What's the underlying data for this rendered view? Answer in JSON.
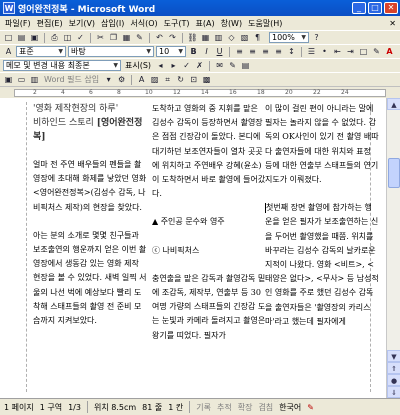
{
  "window": {
    "title": "영어완전정복 - Microsoft Word",
    "icon": "W"
  },
  "menu": [
    "파일(F)",
    "편집(E)",
    "보기(V)",
    "삽입(I)",
    "서식(O)",
    "도구(T)",
    "표(A)",
    "창(W)",
    "도움말(H)"
  ],
  "toolbar": {
    "style_value": "표준",
    "font_value": "바탕",
    "size_value": "10",
    "zoom_value": "100%",
    "track_label": "메모 및 변경 내용 최종본",
    "show_label": "표시(S)",
    "wordart_label": "Word 필드 삽입"
  },
  "ruler": {
    "numbers": [
      "2",
      "4",
      "6",
      "8",
      "10",
      "12",
      "14",
      "16",
      "18",
      "20",
      "22",
      "24"
    ]
  },
  "document": {
    "col1": {
      "heading_a": "'영화 제작현장의 하루'",
      "heading_b": "비하인드 스토리 ",
      "heading_bold": "[영어완전정복]",
      "p1": "얼마 전 주연 배우들의 펜들을 촬영장에 초대해 화제를 낳았던 영화 <영어완전정복>(김성수 감독, 나비픽처스 제작)의 현장을 찾았다.",
      "p2": "아는 분의 소개로 몇몇 친구들과 보조출연의 행운까지 얻은 이번 촬영장에서 생동감 있는 영화 제작 현장을 볼 수 있었다. 새벽 일찍 서울의 나선 벅에 예상보다 빨리 도착해 스태프들의 촬영 전 준비 모습까지 지켜보았다."
    },
    "col2": {
      "p1": "도착하고 영화의 중 지휘를 맡은 김성수 감독이 등장하면서 촬영장은 점점 긴장감이 돌았다. 본디에 대기하던 보조연자들이 열차 곳곳에 위치하고 주연배우 강혜(윤소)이 도착하면서 바로 촬영에 들어갔다.",
      "p2": "▲ 주인공 문수와 영주",
      "p3": "ⓒ 나비픽처스",
      "p4": "충연출을 맡은 감독과 촬영감독 밑에 조감독, 제작부, 연출부 등 30여명 가량의 스태프들의 긴장감 도는 눈빛과 카메라 돌려지고 촬영은 왕기를 띠었다. 필자가"
    },
    "col3": {
      "p1": "이 많이 걸린 편이 아니라는 말에 필자는 놀라지 않을 수 없었다. 감독의 OK사인이 있기 전 촬영 배따다 출연자들에 대한 위치와 표정 등에 대한 연출부 스태프들의 연기 지도가 이뤄졌다.",
      "p2": "첫번째 장면 촬영에 참가하는 행운을 얻은 필자가 보조출연하는 신을 두어번 촬영했을 때쯤. 위치를 바꾸라는 김성수 감독의 날카로운 지적이 나왔다. 영화 <비트>, <태양은 없다>, <무사> 등 남성적인 영화를 주로 했던 김성수 감독을 출연자들은 '촬영장의 카리스마'라고 했는데 필자에게"
    }
  },
  "status": {
    "page": "1 페이지",
    "section": "1 구역",
    "pages": "1/3",
    "position": "위치 8.5cm",
    "line": "81 줄",
    "column": "1 칸",
    "rec": "기록",
    "trk": "추적",
    "ext": "확장",
    "ovr": "겹침",
    "lang": "한국어"
  },
  "colors": {
    "titlebar": "#0a5fd8",
    "chrome": "#ece9d8",
    "page": "#ffffff"
  }
}
